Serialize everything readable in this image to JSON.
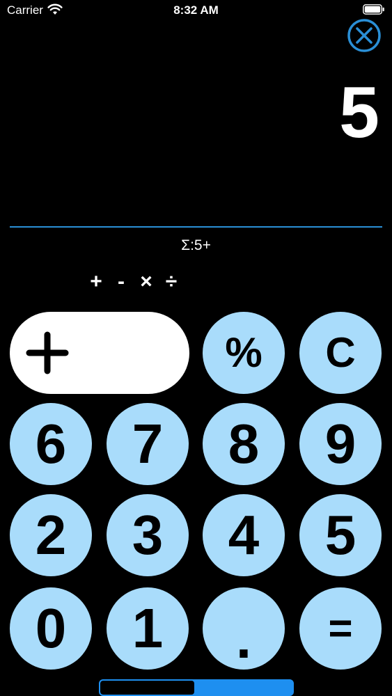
{
  "status_bar": {
    "carrier": "Carrier",
    "time": "8:32 AM"
  },
  "display": {
    "value": "5",
    "expression": "Σ:5+"
  },
  "operators": [
    "+",
    "-",
    "×",
    "÷"
  ],
  "keypad": {
    "operator": "+",
    "percent": "%",
    "clear": "C",
    "six": "6",
    "seven": "7",
    "eight": "8",
    "nine": "9",
    "two": "2",
    "three": "3",
    "four": "4",
    "five": "5",
    "zero": "0",
    "one": "1",
    "decimal": ".",
    "equals": "="
  },
  "progress": {
    "fraction": 0.49
  },
  "colors": {
    "accent": "#2a8fd6",
    "key": "#a9dcfb",
    "progress": "#1e8ff0"
  },
  "icons": {
    "close": "close-circle-icon",
    "wifi": "wifi-icon",
    "battery": "battery-icon"
  }
}
